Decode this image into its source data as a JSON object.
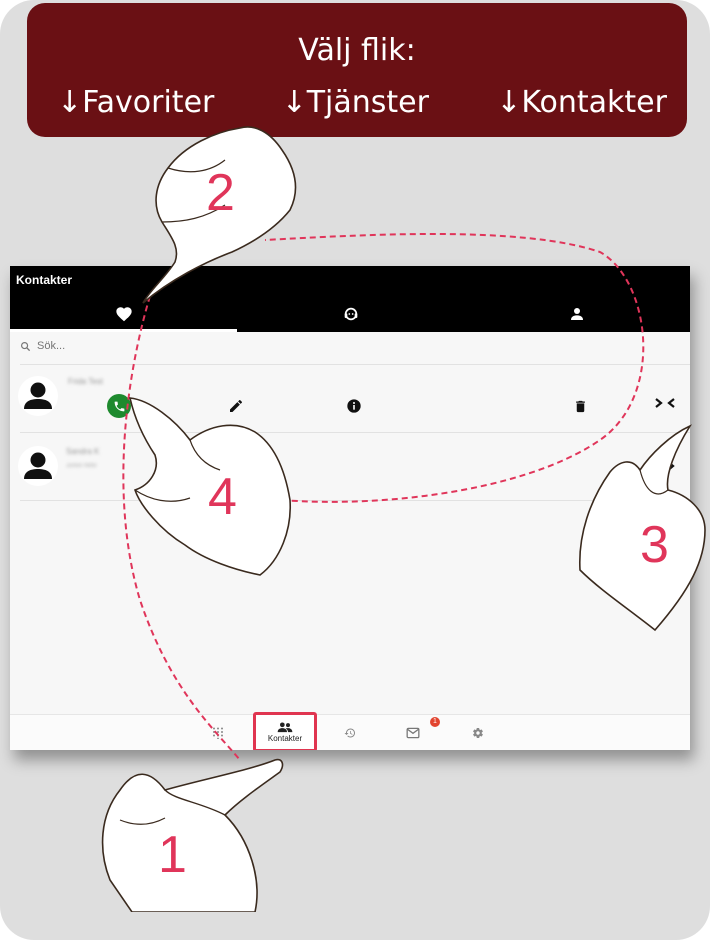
{
  "banner": {
    "title": "Välj flik:",
    "tabs": [
      "↓Favoriter",
      "↓Tjänster",
      "↓Kontakter"
    ]
  },
  "window": {
    "title": "Kontakter",
    "tabs": [
      {
        "icon": "heart-icon",
        "active": true
      },
      {
        "icon": "headset-icon",
        "active": false
      },
      {
        "icon": "person-icon",
        "active": false
      }
    ],
    "search": {
      "placeholder": "Sök..."
    },
    "contacts": [
      {
        "name": "Frida Test",
        "expanded": true,
        "actions": [
          "phone-icon",
          "edit-icon",
          "info-icon",
          "delete-icon",
          "collapse-icon"
        ]
      },
      {
        "name": "Sandra K",
        "subtitle": "Junior Aktiv",
        "expanded": false
      }
    ],
    "nav": {
      "items": [
        "dialpad-icon",
        "contacts-icon",
        "history-icon",
        "mail-icon",
        "settings-icon"
      ],
      "active_label": "Kontakter",
      "mail_badge": "1"
    }
  },
  "colors": {
    "banner": "#6a1014",
    "accent_pink": "#e0355a",
    "call_green": "#1e8a2e",
    "badge": "#e2442f"
  },
  "steps": [
    "1",
    "2",
    "3",
    "4"
  ]
}
